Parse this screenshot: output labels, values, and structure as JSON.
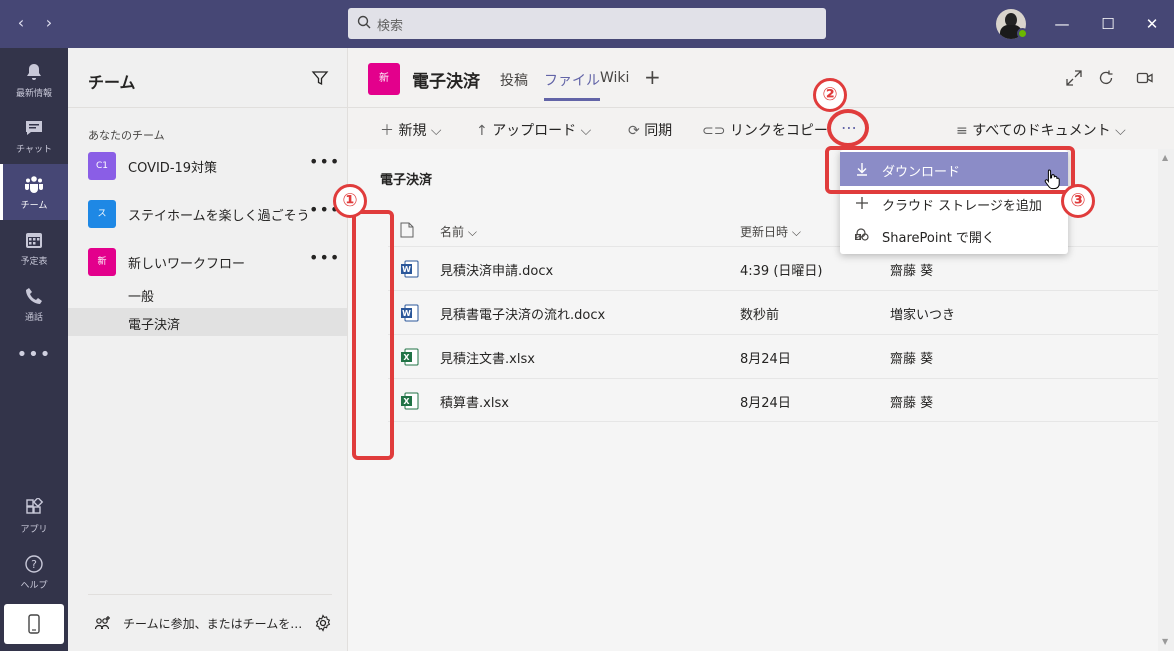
{
  "titlebar": {
    "search_placeholder": "検索"
  },
  "rail": {
    "items": [
      {
        "label": "最新情報",
        "icon": "bell-icon"
      },
      {
        "label": "チャット",
        "icon": "chat-icon"
      },
      {
        "label": "チーム",
        "icon": "teams-icon",
        "active": true
      },
      {
        "label": "予定表",
        "icon": "calendar-icon"
      },
      {
        "label": "通話",
        "icon": "phone-icon"
      }
    ],
    "more": "•••",
    "apps_label": "アプリ",
    "help_label": "ヘルプ"
  },
  "panel": {
    "title": "チーム",
    "section": "あなたのチーム",
    "teams": [
      {
        "tile": "C1",
        "name": "COVID-19対策",
        "color": "#8a5ee6"
      },
      {
        "tile": "ス",
        "name": "ステイホームを楽しく過ごそう",
        "color": "#1e88e5"
      },
      {
        "tile": "新",
        "name": "新しいワークフロー",
        "color": "#e3008c"
      }
    ],
    "channels": [
      "一般",
      "電子決済"
    ],
    "footer": "チームに参加、またはチームを…"
  },
  "header": {
    "tile": "新",
    "title": "電子決済",
    "tabs": [
      "投稿",
      "ファイル",
      "Wiki"
    ],
    "add": "+"
  },
  "cmdbar": {
    "new": "新規",
    "upload": "アップロード",
    "sync": "同期",
    "copy_link": "リンクをコピー",
    "more": "⋯",
    "view": "すべてのドキュメント"
  },
  "files": {
    "breadcrumb": "電子決済",
    "col_name": "名前",
    "col_modified": "更新日時",
    "rows": [
      {
        "type": "word",
        "name": "見積決済申請.docx",
        "modified": "4:39 (日曜日)",
        "author": "齋藤 葵"
      },
      {
        "type": "word",
        "name": "見積書電子決済の流れ.docx",
        "modified": "数秒前",
        "author": "増家いつき"
      },
      {
        "type": "excel",
        "name": "見積注文書.xlsx",
        "modified": "8月24日",
        "author": "齋藤 葵"
      },
      {
        "type": "excel",
        "name": "積算書.xlsx",
        "modified": "8月24日",
        "author": "齋藤 葵"
      }
    ]
  },
  "menu": {
    "items": [
      {
        "label": "ダウンロード",
        "icon": "download-icon"
      },
      {
        "label": "クラウド ストレージを追加",
        "icon": "plus-icon"
      },
      {
        "label": "SharePoint で開く",
        "icon": "sharepoint-icon"
      }
    ]
  },
  "annotations": {
    "badge1": "①",
    "badge2": "②",
    "badge3": "③",
    "accent": "#e03c3c"
  }
}
